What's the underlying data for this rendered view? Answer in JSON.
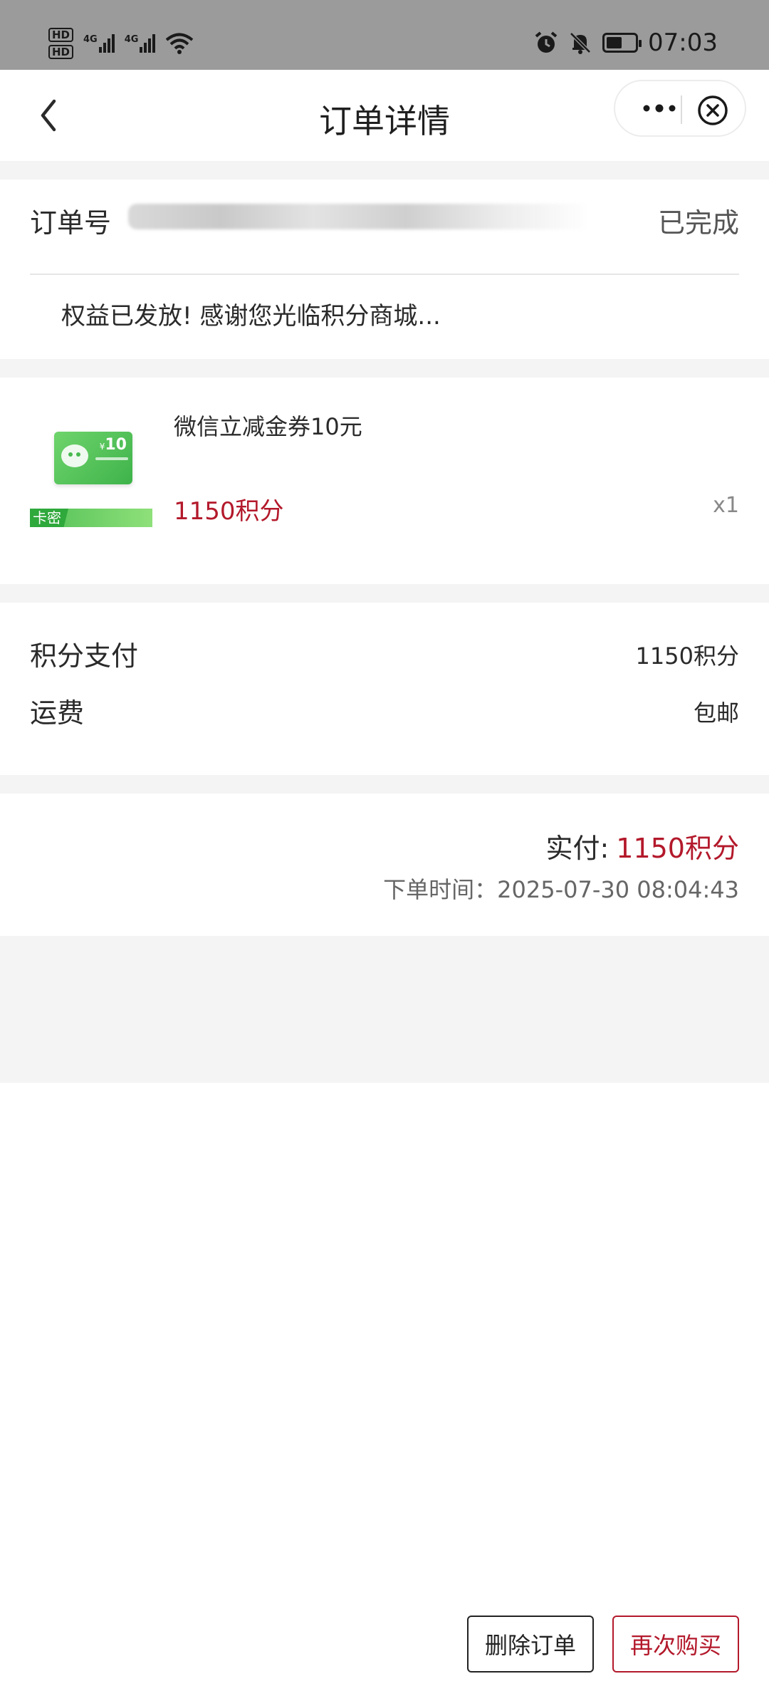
{
  "status_bar": {
    "hd1": "HD",
    "hd2": "HD",
    "net1": "4G",
    "net2": "4G",
    "time": "07:03",
    "battery_level": 0.55,
    "icons": [
      "hd-icon",
      "signal-icon",
      "wifi-icon",
      "alarm-icon",
      "mute-icon",
      "battery-icon"
    ]
  },
  "nav": {
    "title": "订单详情",
    "back_icon": "chevron-left-icon",
    "more_icon": "more-dots-icon",
    "close_icon": "close-circle-icon"
  },
  "order": {
    "number_label": "订单号",
    "status": "已完成",
    "notice": "权益已发放! 感谢您光临积分商城..."
  },
  "product": {
    "tag": "卡密",
    "coupon_value": "10",
    "name": "微信立减金券10元",
    "price": "1150积分",
    "qty": "x1"
  },
  "payment": {
    "points_label": "积分支付",
    "points_value": "1150积分",
    "shipping_label": "运费",
    "shipping_value": "包邮"
  },
  "summary": {
    "paid_label": "实付:",
    "paid_value": "1150积分",
    "order_time": "下单时间：2025-07-30 08:04:43"
  },
  "actions": {
    "delete": "删除订单",
    "rebuy": "再次购买"
  },
  "colors": {
    "accent": "#b3192b",
    "status_bar": "#9b9b9b",
    "gap": "#f4f4f4"
  }
}
